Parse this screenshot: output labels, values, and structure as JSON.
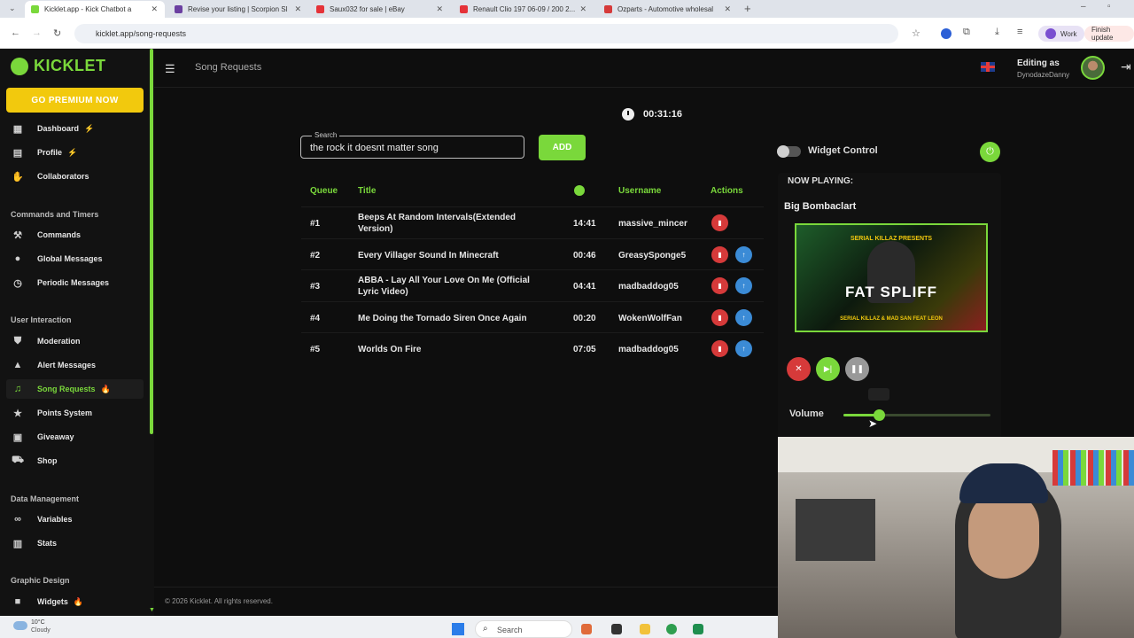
{
  "browser": {
    "tabs": [
      {
        "title": "Kicklet.app - Kick Chatbot a",
        "active": true,
        "color": "#7ad83b"
      },
      {
        "title": "Revise your listing | Scorpion Sl",
        "active": false,
        "color": "#6b3fa0"
      },
      {
        "title": "Saux032 for sale | eBay",
        "active": false,
        "color": "#e53238"
      },
      {
        "title": "Renault Clio 197 06-09 / 200 2...",
        "active": false,
        "color": "#e53238"
      },
      {
        "title": "Ozparts - Automotive wholesal",
        "active": false,
        "color": "#d63a3a"
      }
    ],
    "url": "kicklet.app/song-requests",
    "profile_label": "Work",
    "update_label": "Finish update"
  },
  "sidebar": {
    "brand": "KICKLET",
    "premium_label": "GO PREMIUM NOW",
    "items_top": [
      {
        "label": "Dashboard",
        "badge": "⚡",
        "icon": "grid-icon",
        "glyph": "▦"
      },
      {
        "label": "Profile",
        "badge": "⚡",
        "icon": "id-card-icon",
        "glyph": "▤"
      },
      {
        "label": "Collaborators",
        "badge": "",
        "icon": "handshake-icon",
        "glyph": "✋"
      }
    ],
    "section_commands": "Commands and Timers",
    "items_commands": [
      {
        "label": "Commands",
        "icon": "hammer-icon",
        "glyph": "⚒"
      },
      {
        "label": "Global Messages",
        "icon": "chat-bubble-icon",
        "glyph": "●"
      },
      {
        "label": "Periodic Messages",
        "icon": "clock-icon",
        "glyph": "◷"
      }
    ],
    "section_user": "User Interaction",
    "items_user": [
      {
        "label": "Moderation",
        "icon": "shield-icon",
        "glyph": "⛊"
      },
      {
        "label": "Alert Messages",
        "icon": "warning-icon",
        "glyph": "▲"
      },
      {
        "label": "Song Requests",
        "badge": "🔥",
        "icon": "music-note-icon",
        "glyph": "♫",
        "active": true
      },
      {
        "label": "Points System",
        "icon": "star-icon",
        "glyph": "★"
      },
      {
        "label": "Giveaway",
        "icon": "gift-icon",
        "glyph": "▣"
      },
      {
        "label": "Shop",
        "icon": "cart-icon",
        "glyph": "⛟"
      }
    ],
    "section_data": "Data Management",
    "items_data": [
      {
        "label": "Variables",
        "icon": "link-icon",
        "glyph": "∞"
      },
      {
        "label": "Stats",
        "icon": "bar-chart-icon",
        "glyph": "▥"
      }
    ],
    "section_graphic": "Graphic Design",
    "items_graphic": [
      {
        "label": "Widgets",
        "badge": "🔥",
        "icon": "video-icon",
        "glyph": "■"
      }
    ]
  },
  "header": {
    "page_title": "Song Requests",
    "editing_label": "Editing as",
    "editing_user": "DynodazeDanny"
  },
  "main": {
    "timer": "00:31:16",
    "search_label": "Search",
    "search_value": "the rock it doesnt matter song",
    "add_label": "ADD",
    "columns": {
      "queue": "Queue",
      "title": "Title",
      "username": "Username",
      "actions": "Actions"
    },
    "rows": [
      {
        "pos": "#1",
        "title": "Beeps At Random Intervals(Extended Version)",
        "duration": "14:41",
        "user": "massive_mincer",
        "promote": false
      },
      {
        "pos": "#2",
        "title": "Every Villager Sound In Minecraft",
        "duration": "00:46",
        "user": "GreasySponge5",
        "promote": true
      },
      {
        "pos": "#3",
        "title": "ABBA - Lay All Your Love On Me (Official Lyric Video)",
        "duration": "04:41",
        "user": "madbaddog05",
        "promote": true
      },
      {
        "pos": "#4",
        "title": "Me Doing the Tornado Siren Once Again",
        "duration": "00:20",
        "user": "WokenWolfFan",
        "promote": true
      },
      {
        "pos": "#5",
        "title": "Worlds On Fire",
        "duration": "07:05",
        "user": "madbaddog05",
        "promote": true
      }
    ],
    "footer": "© 2026 Kicklet. All rights reserved."
  },
  "player": {
    "widget_label": "Widget Control",
    "now_playing_label": "NOW PLAYING:",
    "now_playing_title": "Big Bombaclart",
    "artwork_top_text": "SERIAL KILLAZ PRESENTS",
    "artwork_main_text": "FAT SPLIFF",
    "artwork_bottom_text": "SERIAL KILLAZ & MAD SAN FEAT LEON",
    "volume_label": "Volume",
    "volume_level": 0.24,
    "colors": {
      "accent": "#7ad83b",
      "danger": "#d63a3a",
      "info": "#3b8bd6"
    }
  },
  "taskbar": {
    "temp": "10°C",
    "weather": "Cloudy",
    "search_label": "Search"
  }
}
